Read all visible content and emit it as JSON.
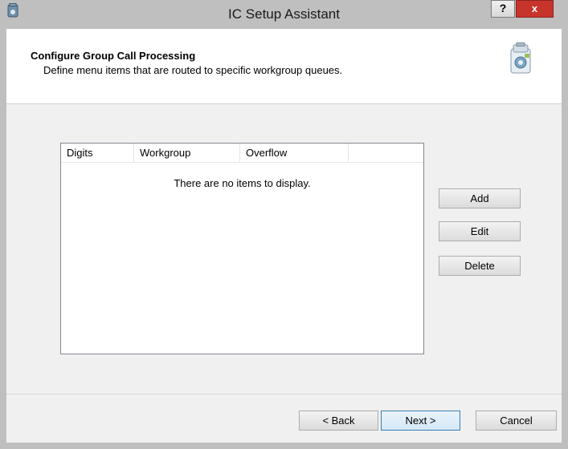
{
  "window": {
    "title": "IC Setup Assistant",
    "help_label": "?",
    "close_label": "x"
  },
  "header": {
    "title": "Configure Group Call Processing",
    "subtitle": "Define menu items that are routed to specific workgroup queues."
  },
  "list": {
    "columns": [
      "Digits",
      "Workgroup",
      "Overflow",
      ""
    ],
    "empty_message": "There are no items to display."
  },
  "side_buttons": {
    "add": "Add",
    "edit": "Edit",
    "delete": "Delete"
  },
  "footer_buttons": {
    "back": "< Back",
    "next": "Next >",
    "cancel": "Cancel"
  },
  "colors": {
    "close": "#c7342c",
    "focus": "#3c7fb1"
  }
}
